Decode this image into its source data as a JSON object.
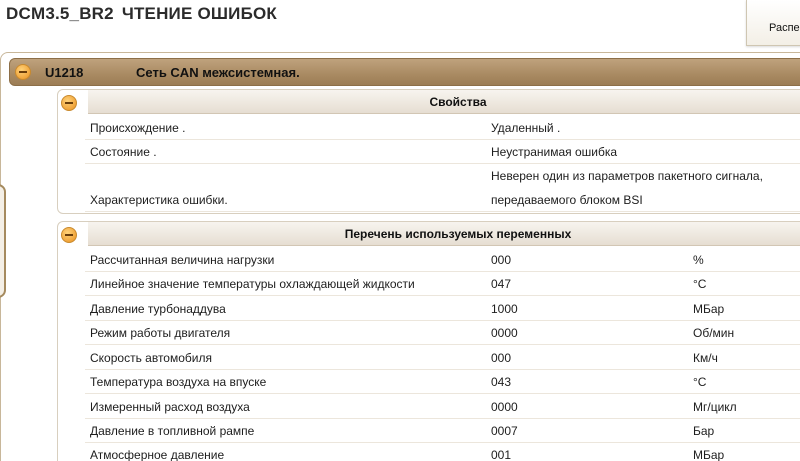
{
  "header": {
    "module": "DCM3.5_BR2",
    "title": "ЧТЕНИЕ ОШИБОК",
    "print_button_label": "Распе"
  },
  "fault": {
    "code": "U1218",
    "description": "Сеть CAN межсистемная."
  },
  "properties": {
    "title": "Свойства",
    "rows": [
      {
        "label": "Происхождение .",
        "value": "Удаленный ."
      },
      {
        "label": "Состояние .",
        "value": "Неустранимая ошибка"
      },
      {
        "label": "Характеристика ошибки.",
        "value_line1": "Неверен один из параметров пакетного сигнала,",
        "value_line2": "передаваемого блоком BSI"
      }
    ]
  },
  "variables": {
    "title": "Перечень используемых переменных",
    "rows": [
      {
        "name": "Рассчитанная величина нагрузки",
        "value": "000",
        "unit": "%"
      },
      {
        "name": "Линейное значение температуры охлаждающей жидкости",
        "value": "047",
        "unit": "°C"
      },
      {
        "name": "Давление турбонаддува",
        "value": "1000",
        "unit": "МБар"
      },
      {
        "name": "Режим работы двигателя",
        "value": "0000",
        "unit": "Об/мин"
      },
      {
        "name": "Скорость автомобиля",
        "value": "000",
        "unit": "Км/ч"
      },
      {
        "name": "Температура воздуха на впуске",
        "value": "043",
        "unit": "°C"
      },
      {
        "name": "Измеренный расход воздуха",
        "value": "0000",
        "unit": "Мг/цикл"
      },
      {
        "name": "Давление в топливной рампе",
        "value": "0007",
        "unit": "Бар"
      },
      {
        "name": "Атмосферное давление",
        "value": "001",
        "unit": "МБар"
      }
    ]
  }
}
